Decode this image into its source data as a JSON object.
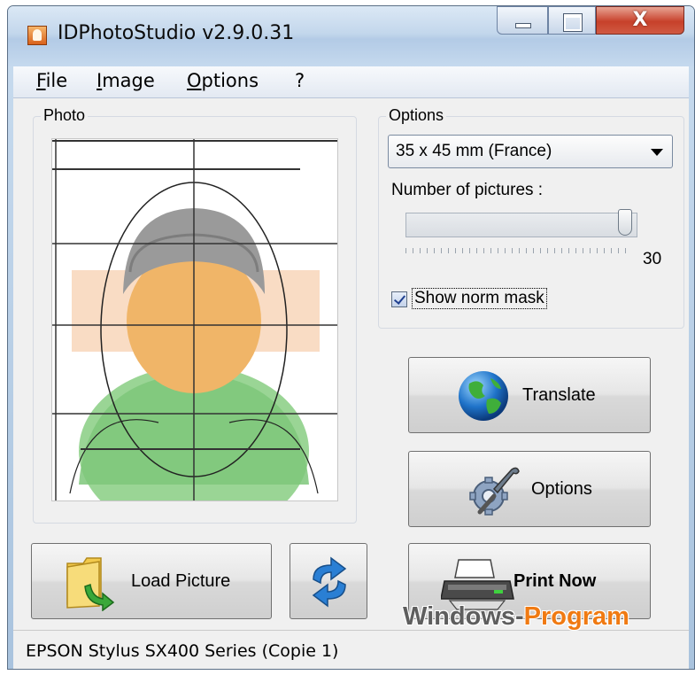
{
  "window": {
    "title": "IDPhotoStudio v2.9.0.31",
    "close_label": "X"
  },
  "menu": {
    "items": [
      "File",
      "Image",
      "Options",
      "?"
    ]
  },
  "photo": {
    "group_label": "Photo"
  },
  "options": {
    "group_label": "Options",
    "format_selected": "35 x 45 mm (France)",
    "pictures_label": "Number of pictures :",
    "pictures_value": "30",
    "pictures_level": 1.0,
    "show_mask_label": "Show norm mask",
    "show_mask_checked": true
  },
  "buttons": {
    "translate": "Translate",
    "options": "Options",
    "print_now": "Print Now",
    "load_picture": "Load Picture"
  },
  "status": {
    "printer": "EPSON Stylus SX400 Series (Copie 1)"
  },
  "watermark": {
    "part1": "Windows-",
    "part2": "Program"
  },
  "colors": {
    "mask_band": "#f9dcc4",
    "face": "#f0b568",
    "body": "#7ec77a",
    "hat": "#9a9a9a",
    "watermark_accent": "#f07a12"
  },
  "icons": [
    "app-icon",
    "globe-icon",
    "wrench-gear-icon",
    "printer-icon",
    "folder-icon",
    "refresh-arrows-icon"
  ]
}
